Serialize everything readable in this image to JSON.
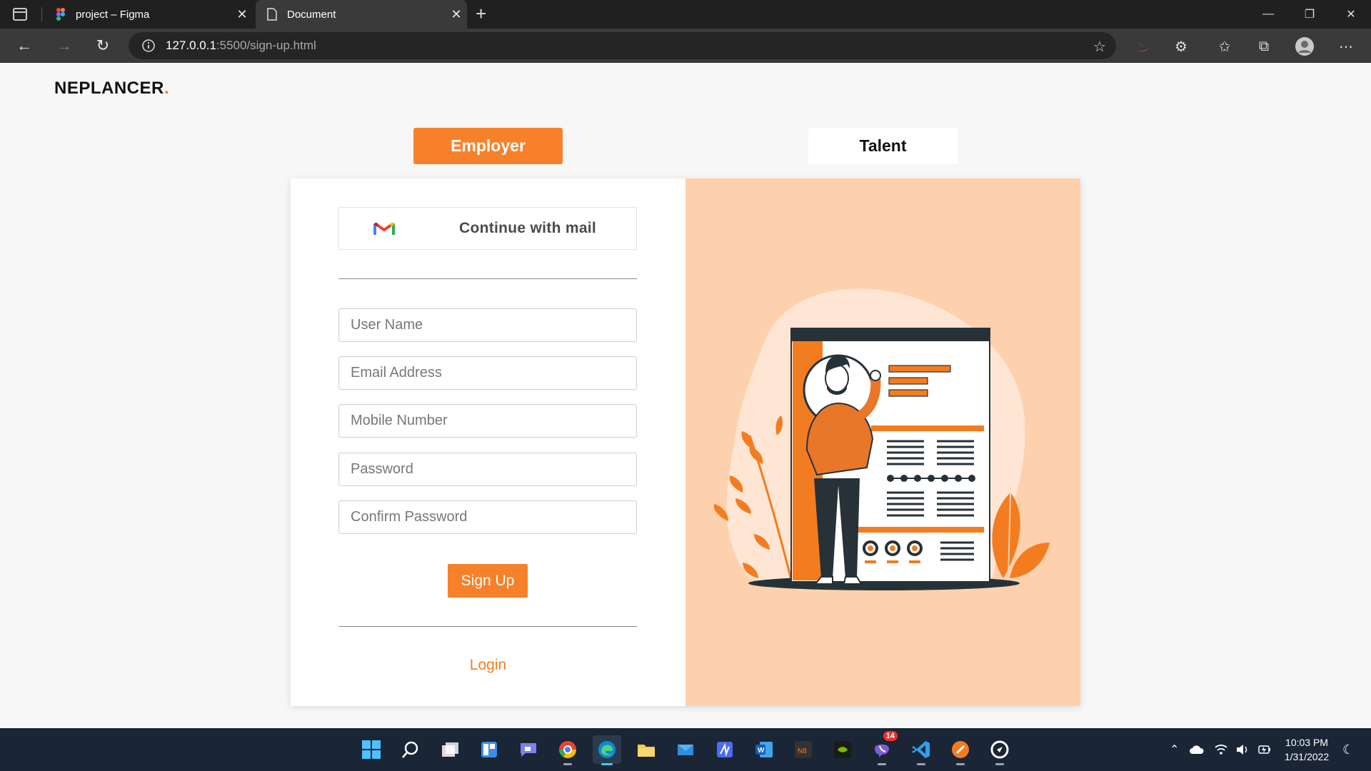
{
  "browser": {
    "tabs": [
      {
        "title": "project – Figma",
        "active": false
      },
      {
        "title": "Document",
        "active": true
      }
    ],
    "url_host": "127.0.0.1",
    "url_path": ":5500/sign-up.html"
  },
  "site": {
    "logo_text": "NEPLANCER",
    "logo_dot": ".",
    "accent_color": "#f7812a",
    "illustration_bg": "#fed1ae"
  },
  "roles": {
    "employer_label": "Employer",
    "talent_label": "Talent",
    "selected": "Employer"
  },
  "form": {
    "continue_mail_label": "Continue with mail",
    "username_placeholder": "User Name",
    "email_placeholder": "Email Address",
    "mobile_placeholder": "Mobile Number",
    "password_placeholder": "Password",
    "confirm_password_placeholder": "Confirm Password",
    "signup_label": "Sign Up",
    "login_label": "Login"
  },
  "taskbar": {
    "apps": [
      "windows-start",
      "search",
      "task-view",
      "widgets",
      "teams-chat",
      "chrome",
      "edge",
      "file-explorer",
      "mail",
      "app-1",
      "word",
      "sn8",
      "nvidia",
      "viber",
      "vscode",
      "app-2",
      "app-3"
    ],
    "viber_badge": "14",
    "time": "10:03 PM",
    "date": "1/31/2022"
  }
}
